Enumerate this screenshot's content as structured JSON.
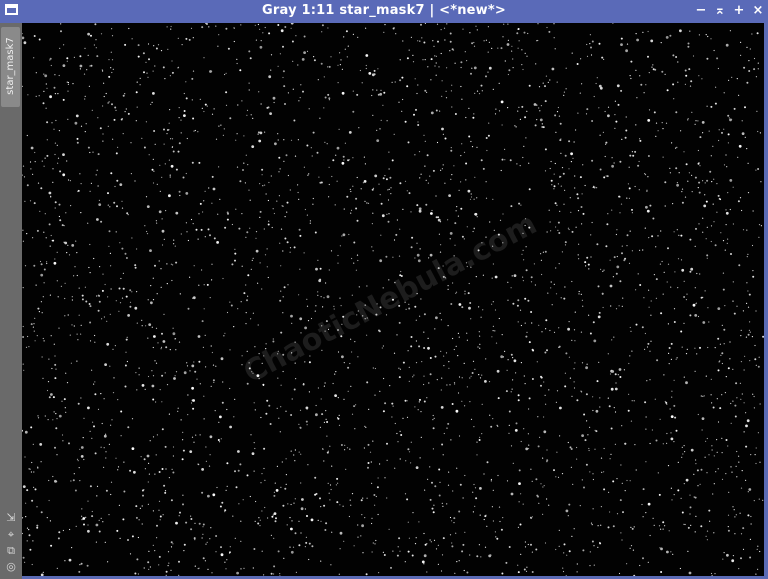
{
  "window": {
    "title": "Gray 1:11 star_mask7 | <*new*>",
    "controls": {
      "minimize": "−",
      "shade": "⌅",
      "maximize": "+",
      "close": "×"
    }
  },
  "sidebar": {
    "tab_label": "star_mask7",
    "tools": [
      {
        "name": "fit-view-icon",
        "glyph": "⇲"
      },
      {
        "name": "zoom-icon",
        "glyph": "⌖"
      },
      {
        "name": "clone-icon",
        "glyph": "⧉"
      },
      {
        "name": "target-icon",
        "glyph": "◎"
      }
    ]
  },
  "image": {
    "watermark": "ChaoticNebula.com"
  },
  "colors": {
    "titlebar": "#5a6ab8",
    "frame": "#5b6bb5",
    "background": "#020202",
    "sidebar": "#6a6a6a"
  }
}
